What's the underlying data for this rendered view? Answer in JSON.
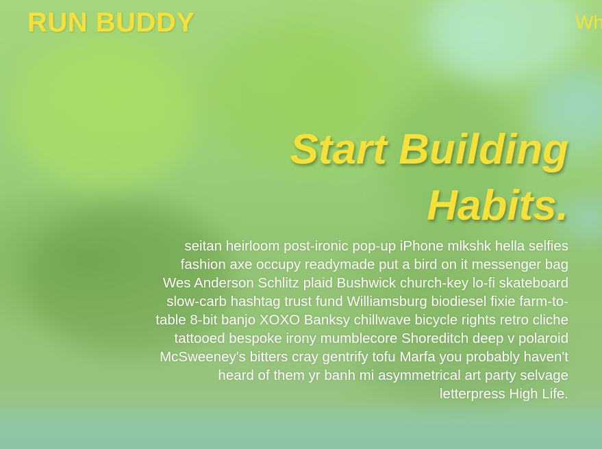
{
  "header": {
    "brand": "RUN BUDDY",
    "nav": [
      {
        "label": "Wh"
      }
    ]
  },
  "hero": {
    "title_lines": [
      "Start Building",
      "Habits."
    ],
    "body_lines": [
      "seitan heirloom post-ironic pop-up iPhone mlkshk hella selfies",
      "fashion axe occupy readymade put a bird on it messenger bag",
      "Wes Anderson Schlitz plaid Bushwick church-key lo-fi skateboard",
      "slow-carb hashtag trust fund Williamsburg biodiesel fixie farm-to-",
      "table 8-bit banjo XOXO Banksy chillwave bicycle rights retro cliche",
      "tattooed bespoke irony mumblecore Shoreditch deep v polaroid",
      "McSweeney's bitters cray gentrify tofu Marfa you probably haven't",
      "heard of them yr banh mi asymmetrical art party selvage",
      "letterpress High Life."
    ]
  },
  "colors": {
    "accent": "#f6e03a",
    "body_text": "#ffffff",
    "background": "#9fd17a"
  }
}
